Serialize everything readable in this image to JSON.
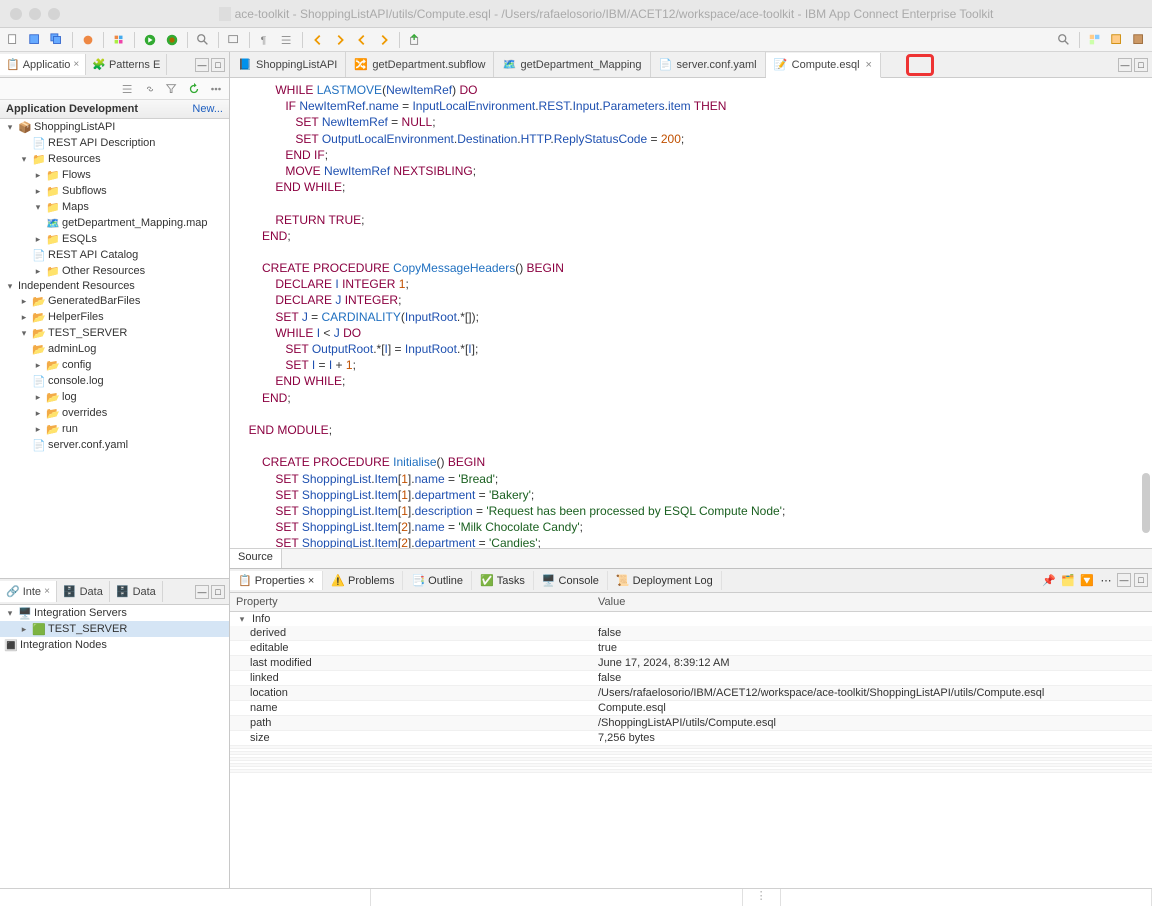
{
  "title": "ace-toolkit - ShoppingListAPI/utils/Compute.esql - /Users/rafaelosorio/IBM/ACET12/workspace/ace-toolkit - IBM App Connect Enterprise Toolkit",
  "leftTopTabs": {
    "t1": "Applicatio",
    "t2": "Patterns E"
  },
  "leftBottomTabs": {
    "t1": "Inte",
    "t2": "Data",
    "t3": "Data"
  },
  "appdev_label": "Application Development",
  "new_label": "New...",
  "tree": {
    "shoppingListAPI": "ShoppingListAPI",
    "restApiDesc": "REST API Description",
    "resources": "Resources",
    "flows": "Flows",
    "subflows": "Subflows",
    "maps": "Maps",
    "getDepartmentMap": "getDepartment_Mapping.map",
    "esqls": "ESQLs",
    "restApiCatalog": "REST API Catalog",
    "otherResources": "Other Resources",
    "independentResources": "Independent Resources",
    "generatedBarFiles": "GeneratedBarFiles",
    "helperFiles": "HelperFiles",
    "testServer": "TEST_SERVER",
    "adminLog": "adminLog",
    "config": "config",
    "consoleLog": "console.log",
    "log": "log",
    "overrides": "overrides",
    "run": "run",
    "serverConfYaml": "server.conf.yaml"
  },
  "integrationTree": {
    "integrationServers": "Integration Servers",
    "testServer": "TEST_SERVER",
    "integrationNodes": "Integration Nodes"
  },
  "editorTabs": {
    "t1": "ShoppingListAPI",
    "t2": "getDepartment.subflow",
    "t3": "getDepartment_Mapping",
    "t4": "server.conf.yaml",
    "t5": "Compute.esql"
  },
  "sourceTab": "Source",
  "bottomTabs": {
    "properties": "Properties",
    "problems": "Problems",
    "outline": "Outline",
    "tasks": "Tasks",
    "console": "Console",
    "deployLog": "Deployment Log"
  },
  "propHeaders": {
    "prop": "Property",
    "val": "Value"
  },
  "propGroup": "Info",
  "propRows": {
    "derived": {
      "k": "derived",
      "v": "false"
    },
    "editable": {
      "k": "editable",
      "v": "true"
    },
    "lastModified": {
      "k": "last modified",
      "v": "June 17, 2024, 8:39:12 AM"
    },
    "linked": {
      "k": "linked",
      "v": "false"
    },
    "location": {
      "k": "location",
      "v": "/Users/rafaelosorio/IBM/ACET12/workspace/ace-toolkit/ShoppingListAPI/utils/Compute.esql"
    },
    "name": {
      "k": "name",
      "v": "Compute.esql"
    },
    "path": {
      "k": "path",
      "v": "/ShoppingListAPI/utils/Compute.esql"
    },
    "size": {
      "k": "size",
      "v": "7,256  bytes"
    }
  }
}
